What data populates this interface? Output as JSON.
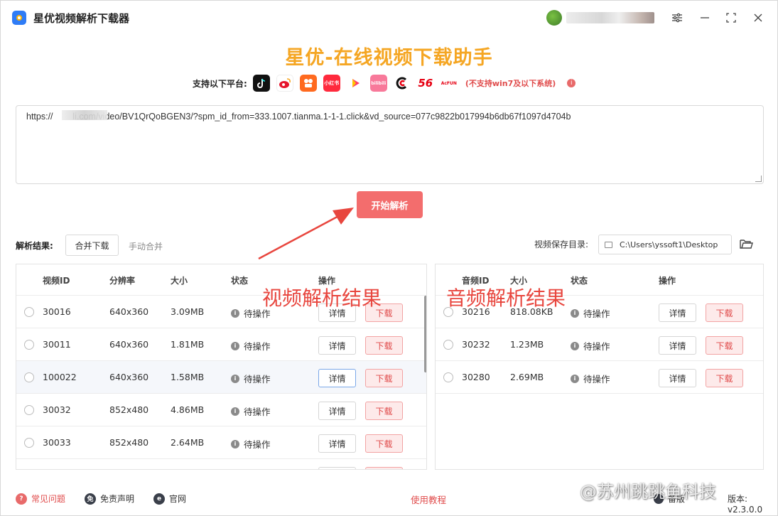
{
  "app": {
    "title": "星优视频解析下载器"
  },
  "header": {
    "hero_title": "星优-在线视频下载助手",
    "platform_label": "支持以下平台:",
    "platforms": [
      {
        "icon": "douyin-icon",
        "text": "",
        "color": "#111111"
      },
      {
        "icon": "weibo-icon",
        "text": "",
        "color": "#f5a623"
      },
      {
        "icon": "kuaishou-icon",
        "text": "",
        "color": "#ff6a1f"
      },
      {
        "icon": "xiaohongshu-icon",
        "text": "小红书",
        "color": "#ff2a3d"
      },
      {
        "icon": "iqiyi-play-icon",
        "text": "",
        "color": "#ffffff"
      },
      {
        "icon": "bilibili-icon",
        "text": "bilibili",
        "color": "#f8799a"
      },
      {
        "icon": "mango-icon",
        "text": "",
        "color": "#ffffff"
      },
      {
        "icon": "56-icon",
        "text": "56",
        "color": "#ffffff"
      },
      {
        "icon": "acfun-icon",
        "text": "AcFUN",
        "color": "#ffffff"
      }
    ],
    "notice": "(不支持win7及以下系统)",
    "info_icon": "i"
  },
  "url_input": {
    "value": "https://        li.com/video/BV1QrQoBGEN3/?spm_id_from=333.1007.tianma.1-1-1.click&vd_source=077c9822b017994b6db67f1097d4704b"
  },
  "parse_button": "开始解析",
  "results": {
    "label": "解析结果:",
    "merge_download": "合并下载",
    "manual_merge": "手动合并",
    "save_dir_label": "视频保存目录:",
    "save_dir_value": "C:\\Users\\yssoft1\\Desktop"
  },
  "video_table": {
    "headers": [
      "视频ID",
      "分辨率",
      "大小",
      "状态",
      "操作"
    ],
    "rows": [
      {
        "id": "30016",
        "res": "640x360",
        "size": "3.09MB",
        "status": "待操作"
      },
      {
        "id": "30011",
        "res": "640x360",
        "size": "1.81MB",
        "status": "待操作"
      },
      {
        "id": "100022",
        "res": "640x360",
        "size": "1.58MB",
        "status": "待操作"
      },
      {
        "id": "30032",
        "res": "852x480",
        "size": "4.86MB",
        "status": "待操作"
      },
      {
        "id": "30033",
        "res": "852x480",
        "size": "2.64MB",
        "status": "待操作"
      }
    ],
    "detail_label": "详情",
    "download_label": "下载"
  },
  "audio_table": {
    "headers": [
      "音频ID",
      "大小",
      "状态",
      "操作"
    ],
    "rows": [
      {
        "id": "30216",
        "size": "818.08KB",
        "status": "待操作"
      },
      {
        "id": "30232",
        "size": "1.23MB",
        "status": "待操作"
      },
      {
        "id": "30280",
        "size": "2.69MB",
        "status": "待操作"
      }
    ],
    "detail_label": "详情",
    "download_label": "下载"
  },
  "annotations": {
    "video_result": "视频解析结果",
    "audio_result": "音频解析结果"
  },
  "footer": {
    "faq": "常见问题",
    "disclaimer": "免责声明",
    "website": "官网",
    "tutorial": "使用教程",
    "backup": "备版",
    "version": "版本: v2.3.0.0",
    "faq_icon": "?",
    "disclaimer_icon": "免",
    "website_icon": "e"
  },
  "watermark": "@苏州跳跳鱼科技",
  "colors": {
    "accent": "#f36d6d",
    "hero": "#f5a623",
    "danger": "#e04b4b"
  }
}
